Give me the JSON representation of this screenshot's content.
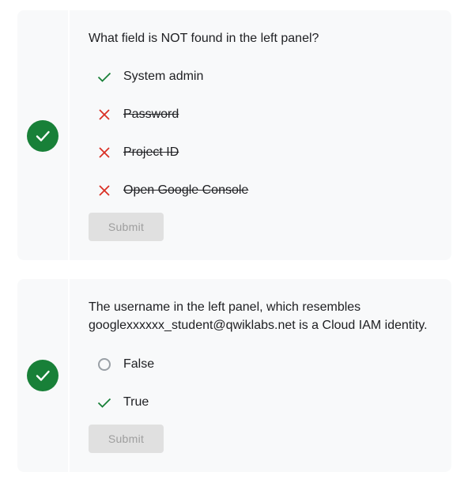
{
  "colors": {
    "correct": "#188038",
    "incorrect": "#d93025",
    "card_bg": "#f8f9fa",
    "button_bg": "#e0e0e0",
    "button_text": "#9e9e9e"
  },
  "questions": [
    {
      "status_icon": "check-icon",
      "text": "What field is NOT found in the left panel?",
      "options": [
        {
          "label": "System admin",
          "icon": "check-icon",
          "struck": false
        },
        {
          "label": "Password",
          "icon": "x-icon",
          "struck": true
        },
        {
          "label": "Project ID",
          "icon": "x-icon",
          "struck": true
        },
        {
          "label": "Open Google Console",
          "icon": "x-icon",
          "struck": true
        }
      ],
      "submit_label": "Submit"
    },
    {
      "status_icon": "check-icon",
      "text": "The username in the left panel, which resembles googlexxxxxx_student@qwiklabs.net is a Cloud IAM identity.",
      "options": [
        {
          "label": "False",
          "icon": "radio-icon",
          "struck": false
        },
        {
          "label": "True",
          "icon": "check-icon",
          "struck": false
        }
      ],
      "submit_label": "Submit"
    }
  ]
}
